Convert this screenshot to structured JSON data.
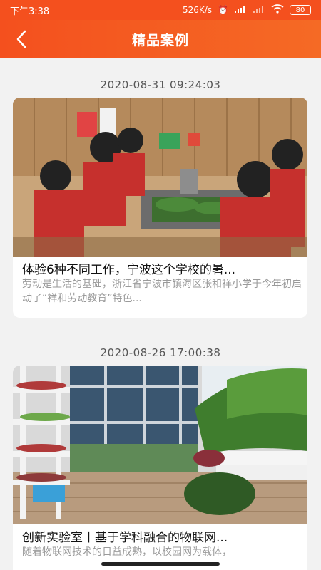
{
  "status_bar": {
    "time": "下午3:38",
    "network_speed": "526K/s",
    "battery": "80",
    "icons": [
      "alarm-clock-icon",
      "hd-signal-icon",
      "signal-icon",
      "wifi-icon",
      "battery-icon"
    ]
  },
  "header": {
    "title": "精品案例",
    "back_icon": "chevron-left-icon",
    "color": "#f4501e"
  },
  "cases": [
    {
      "date": "2020-08-31 09:24:03",
      "title": "体验6种不同工作，宁波这个学校的暑...",
      "summary": "劳动是生活的基础，浙江省宁波市镇海区张和祥小学于今年初启动了“祥和劳动教育”特色..."
    },
    {
      "date": "2020-08-26 17:00:38",
      "title": "创新实验室丨基于学科融合的物联网...",
      "summary": "随着物联网技术的日益成熟，以校园网为载体，"
    }
  ]
}
